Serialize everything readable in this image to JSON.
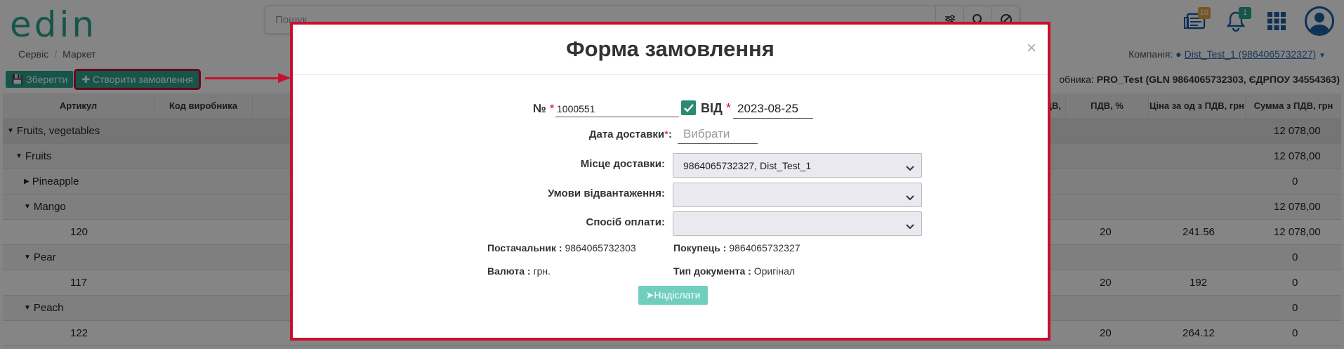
{
  "header": {
    "logo": "edin",
    "search_placeholder": "Пошук",
    "badges": {
      "news": "10",
      "notifications": "1"
    }
  },
  "breadcrumb": [
    "Сервіс",
    "Маркет"
  ],
  "company": {
    "label": "Компанія:",
    "value": "Dist_Test_1 (9864065732327)"
  },
  "toolbar": {
    "save_label": "Зберегти",
    "create_order_label": "Створити замовлення"
  },
  "supplier_info": {
    "prefix": "обника:",
    "value": "PRO_Test (GLN 9864065732303, ЄДРПОУ 34554363)"
  },
  "grid": {
    "columns": [
      "Артикул",
      "Код виробника",
      "ДВ,",
      "ПДВ, %",
      "Ціна за од з ПДВ, грн",
      "Сумма з ПДВ, грн"
    ],
    "rows": [
      {
        "label": "Fruits, vegetables",
        "sum": "12 078,00"
      },
      {
        "label": "Fruits",
        "sum": "12 078,00"
      },
      {
        "label": "Pineapple",
        "sum": "0"
      },
      {
        "label": "Mango",
        "sum": "12 078,00"
      },
      {
        "article": "120",
        "vat": "20",
        "price": "241.56",
        "sum": "12 078,00"
      },
      {
        "label": "Pear",
        "sum": "0"
      },
      {
        "article": "117",
        "vat": "20",
        "price": "192",
        "sum": "0"
      },
      {
        "label": "Peach",
        "sum": "0"
      },
      {
        "article": "122",
        "vat": "20",
        "price": "264.12",
        "sum": "0"
      }
    ]
  },
  "modal": {
    "title": "Форма замовлення",
    "close": "×",
    "number_label": "№",
    "number_value": "1000551",
    "date_from_label": "ВІД",
    "date_from_value": "2023-08-25",
    "delivery_date_label": "Дата доставки",
    "delivery_date_placeholder": "Вибрати",
    "delivery_place_label": "Місце доставки:",
    "delivery_place_value": "9864065732327, Dist_Test_1",
    "shipping_terms_label": "Умови відвантаження:",
    "payment_method_label": "Спосіб оплати:",
    "supplier_label": "Постачальник :",
    "supplier_value": "9864065732303",
    "buyer_label": "Покупець :",
    "buyer_value": "9864065732327",
    "currency_label": "Валюта :",
    "currency_value": "грн.",
    "doc_type_label": "Тип документа :",
    "doc_type_value": "Оригінал",
    "send_label": "Надіслати",
    "required_mark": "*"
  },
  "colors": {
    "accent": "#2aa38e",
    "highlight": "#c8102e",
    "link": "#2b6cb0"
  }
}
